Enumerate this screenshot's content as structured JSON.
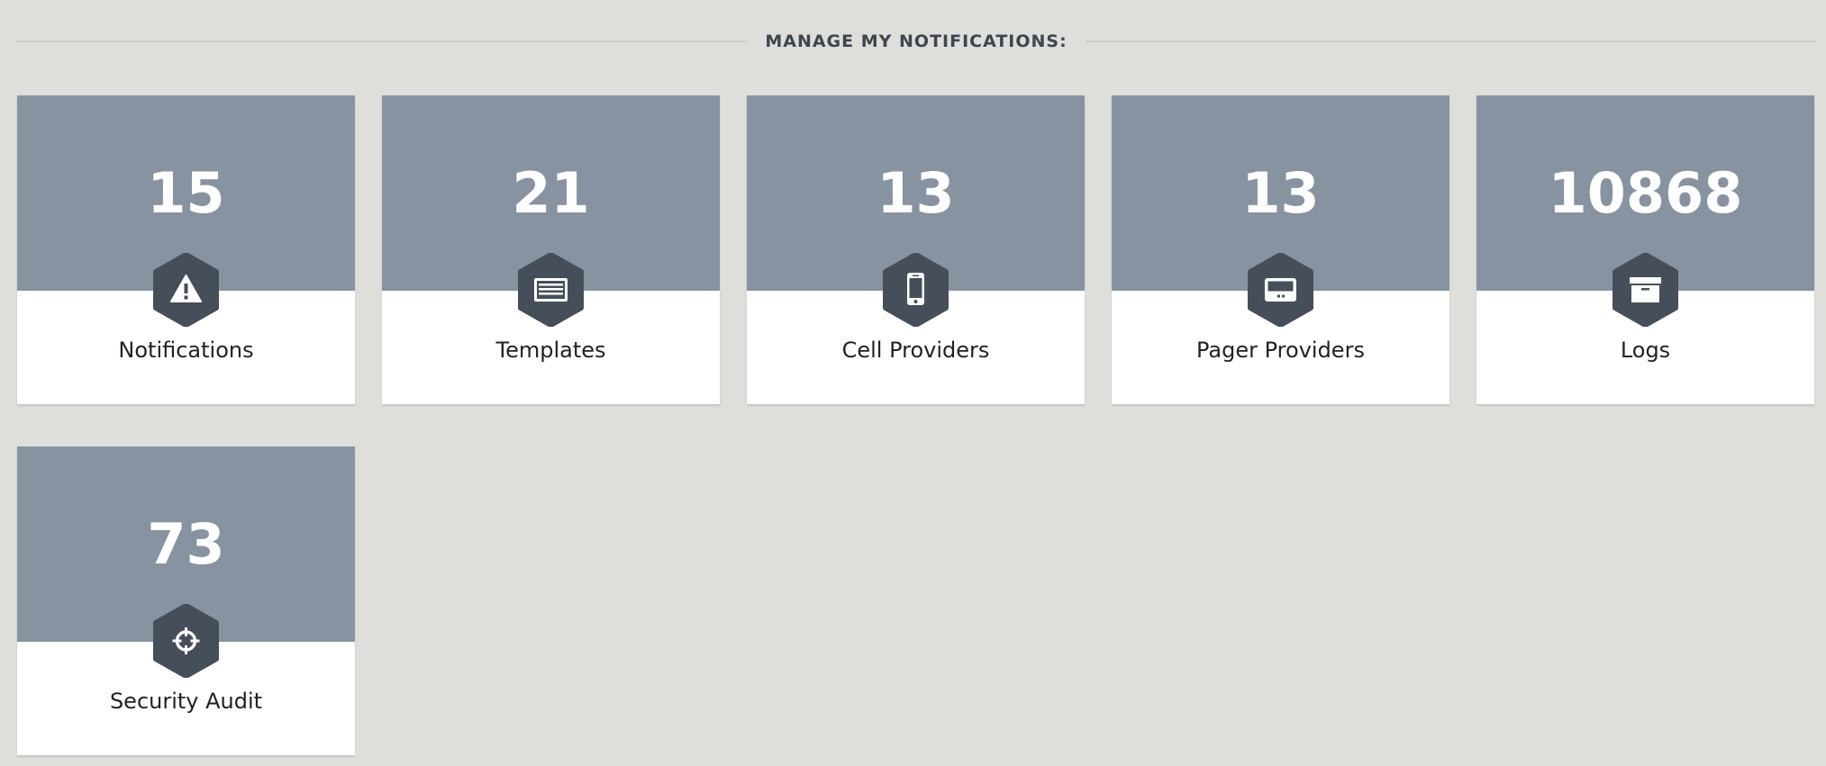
{
  "header": {
    "title": "MANAGE MY NOTIFICATIONS:"
  },
  "colors": {
    "background": "#dededb",
    "tile_top": "#8893a1",
    "hexagon": "#464e59",
    "tile_bottom": "#ffffff"
  },
  "tiles": [
    {
      "count": "15",
      "label": "Notifications",
      "icon": "warning-icon"
    },
    {
      "count": "21",
      "label": "Templates",
      "icon": "list-card-icon"
    },
    {
      "count": "13",
      "label": "Cell Providers",
      "icon": "mobile-phone-icon"
    },
    {
      "count": "13",
      "label": "Pager Providers",
      "icon": "pager-icon"
    },
    {
      "count": "10868",
      "label": "Logs",
      "icon": "archive-box-icon"
    },
    {
      "count": "73",
      "label": "Security Audit",
      "icon": "crosshair-icon"
    }
  ]
}
